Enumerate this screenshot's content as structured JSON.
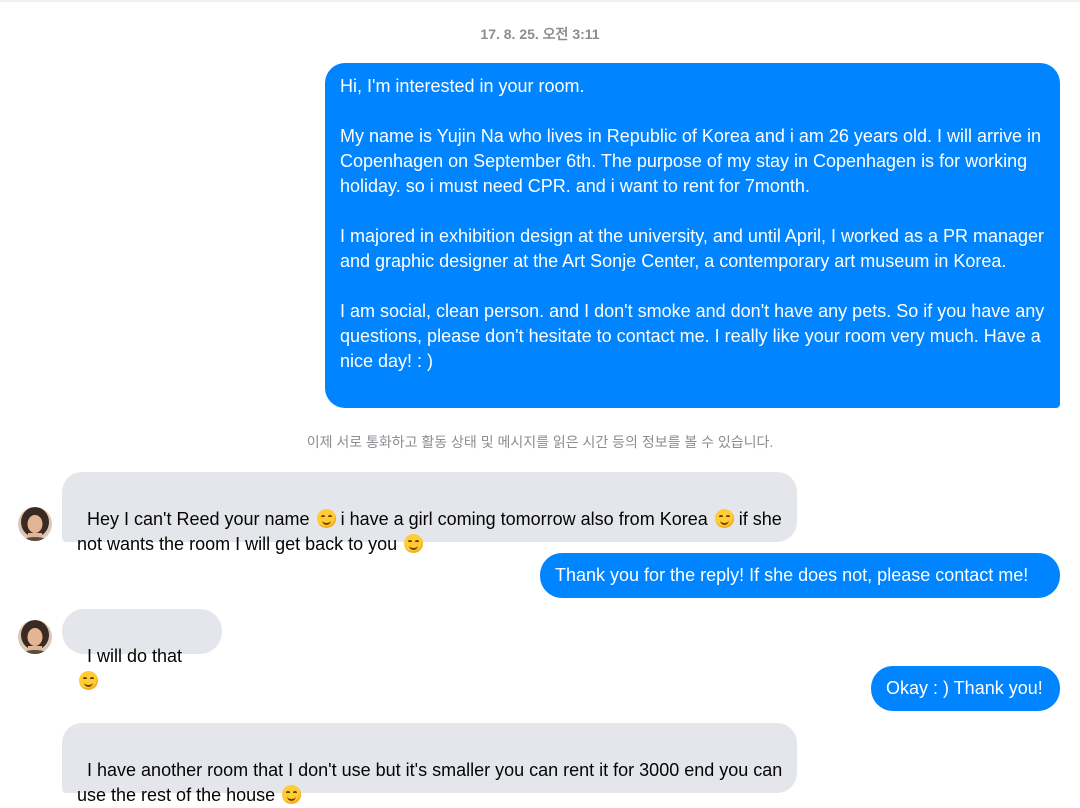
{
  "thread": {
    "timestamp": "17. 8. 25. 오전 3:11",
    "notice": "이제 서로 통화하고 활동 상태 및 메시지를 읽은 시간 등의 정보를 볼 수 있습니다."
  },
  "messages": [
    {
      "direction": "outgoing",
      "text": "Hi, I'm interested in your room.\n\nMy name is Yujin Na who lives in Republic of Korea and i am 26 years old. I will arrive in Copenhagen on September 6th. The purpose of my stay in Copenhagen is for working holiday. so i must need CPR. and i want to rent for 7month.\n\nI majored in exhibition design at the university, and until April, I worked as a PR manager and graphic designer at the Art Sonje Center, a contemporary art museum in Korea.\n\nI am social, clean person. and I don't smoke and don't have any pets. So if you have any questions, please don't hesitate to contact me. I really like your room very much. Have a nice day! : )"
    },
    {
      "direction": "incoming",
      "parts": [
        "Hey I can't Reed your name ",
        " i have a girl coming tomorrow also from Korea ",
        " if she not wants the room I will get back to you ",
        ""
      ],
      "emoji": "smiling-face-emoji"
    },
    {
      "direction": "outgoing",
      "text": "Thank you for the reply! If she does not, please contact me!"
    },
    {
      "direction": "incoming",
      "parts": [
        "I will do that ",
        ""
      ],
      "emoji": "smiling-face-emoji"
    },
    {
      "direction": "outgoing",
      "text": "Okay : ) Thank you!"
    },
    {
      "direction": "incoming",
      "parts": [
        "I have another room that I don't use but it's smaller you can rent it for 3000 end you can use the rest of the house ",
        ""
      ],
      "emoji": "smiling-face-emoji"
    }
  ],
  "colors": {
    "outgoing_bubble": "#0084ff",
    "incoming_bubble": "#e4e6eb",
    "meta_text": "#8a8d91"
  },
  "icons": {
    "avatar": "contact-avatar",
    "emoji": "smiling-face-emoji"
  }
}
